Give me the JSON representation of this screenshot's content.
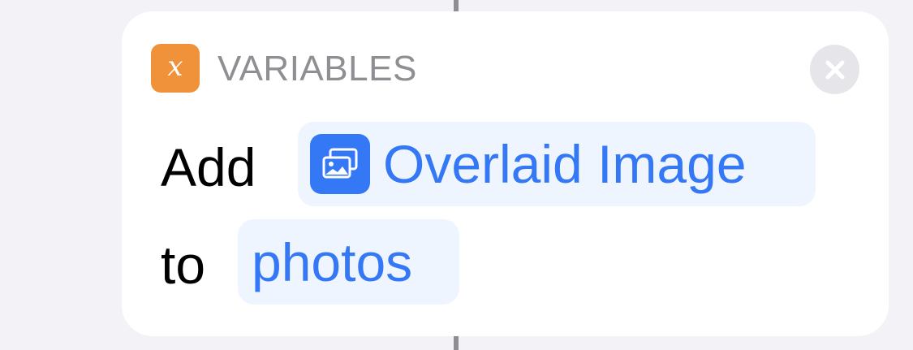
{
  "colors": {
    "background": "#f2f2f7",
    "card": "#ffffff",
    "category_icon": "#f0923a",
    "category_text": "#8e8e93",
    "token_background": "#eef5fe",
    "token_text": "#3478f6",
    "token_icon": "#3478f6",
    "close_button": "#e5e5ea",
    "connector": "#8e8e93"
  },
  "action": {
    "category": {
      "icon_glyph": "x",
      "icon": "variable-x-icon",
      "label": "VARIABLES"
    },
    "close_icon": "close-x-icon",
    "line1": {
      "verb": "Add",
      "variable": {
        "icon": "photo-gallery-icon",
        "label": "Overlaid Image"
      }
    },
    "line2": {
      "preposition": "to",
      "parameter": {
        "label": "photos"
      }
    }
  }
}
